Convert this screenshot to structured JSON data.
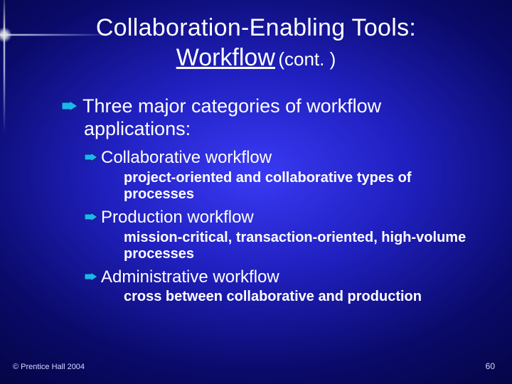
{
  "title": {
    "line1": "Collaboration-Enabling Tools:",
    "line2_main": "Workflow",
    "line2_paren": "(cont. )"
  },
  "heading": "Three major categories of workflow applications:",
  "items": [
    {
      "name": "Collaborative workflow",
      "desc": "project-oriented and collaborative types of processes"
    },
    {
      "name": "Production workflow",
      "desc": "mission-critical, transaction-oriented, high-volume processes"
    },
    {
      "name": "Administrative workflow",
      "desc": "cross between collaborative and production"
    }
  ],
  "footer": {
    "copyright": "© Prentice Hall 2004",
    "page": "60"
  },
  "colors": {
    "arrow_fill": "#1bb6f0",
    "arrow_stroke": "#0a2a8a"
  }
}
